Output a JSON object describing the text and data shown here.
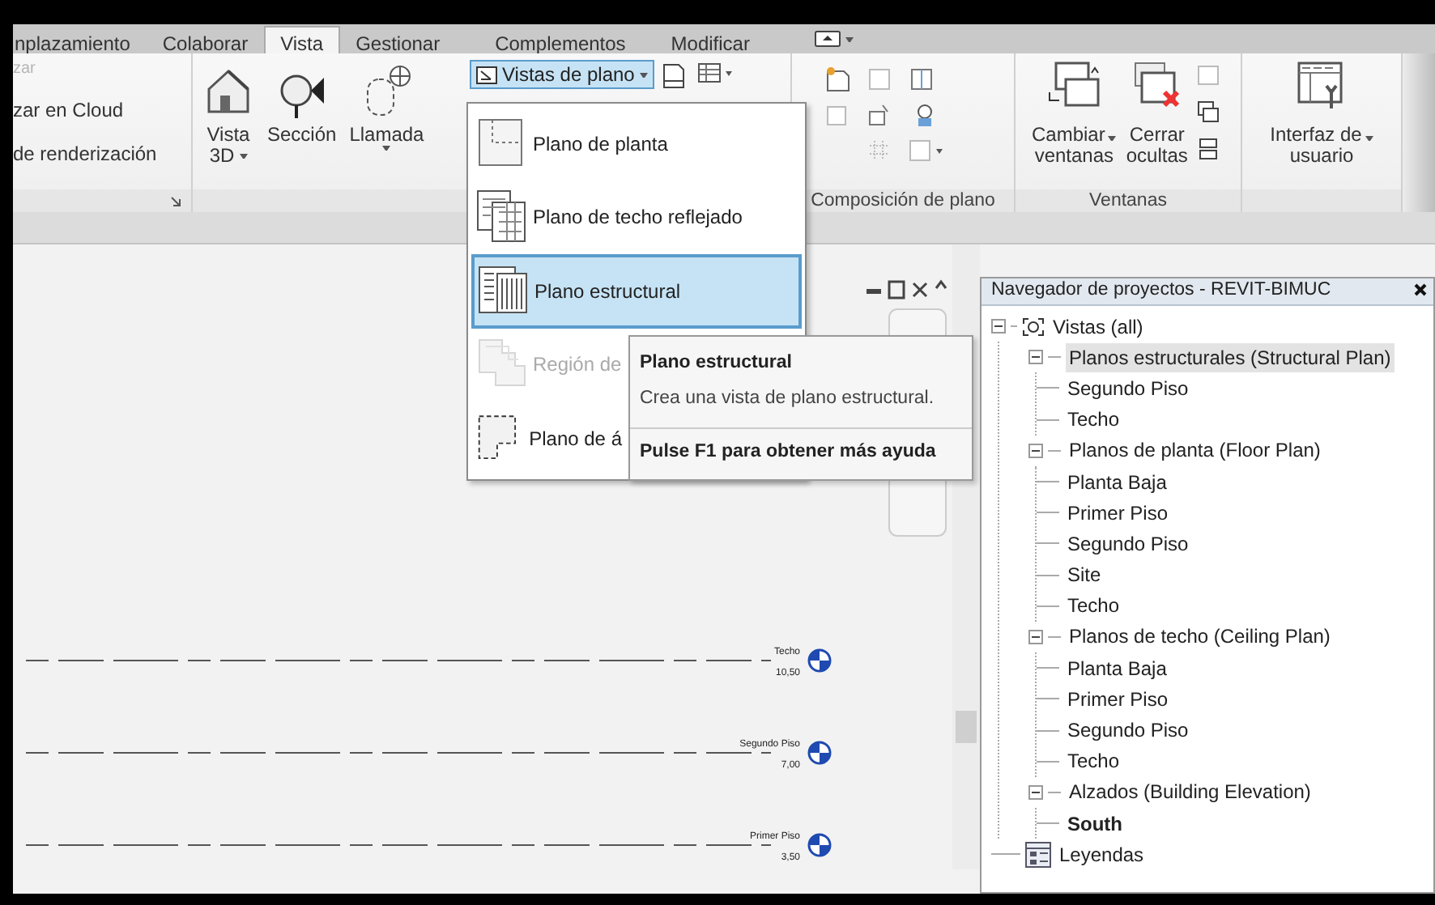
{
  "ribbon_tabs": [
    {
      "label": "nplazamiento",
      "selected": false
    },
    {
      "label": "Colaborar",
      "selected": false
    },
    {
      "label": "Vista",
      "selected": true
    },
    {
      "label": "Gestionar",
      "selected": false
    },
    {
      "label": "Complementos",
      "selected": false
    },
    {
      "label": "Modificar",
      "selected": false
    }
  ],
  "panel_cut": {
    "items": [
      {
        "label": "zar",
        "disabled": true
      },
      {
        "label": "zar en Cloud",
        "disabled": false
      },
      {
        "label": "de renderización",
        "disabled": false
      }
    ]
  },
  "create_panel": {
    "buttons": [
      {
        "kind": "view3d",
        "label": "Vista",
        "label_2": "3D",
        "dropdown": true
      },
      {
        "kind": "section",
        "label": "Sección",
        "dropdown": false
      },
      {
        "kind": "callout",
        "label": "Llamada",
        "dropdown": true
      }
    ]
  },
  "plan_views_button": {
    "label": "Vistas de plano",
    "expanded": true
  },
  "plan_menu": [
    {
      "kind": "floor",
      "label": "Plano de planta",
      "selected": false,
      "disabled": false
    },
    {
      "kind": "ceiling",
      "label": "Plano de techo reflejado",
      "selected": false,
      "disabled": false
    },
    {
      "kind": "structural",
      "label": "Plano estructural",
      "selected": true,
      "disabled": false
    },
    {
      "kind": "region",
      "label": "Región de",
      "selected": false,
      "disabled": true
    },
    {
      "kind": "area",
      "label": "Plano de á",
      "selected": false,
      "disabled": false
    }
  ],
  "tooltip": {
    "title": "Plano estructural",
    "description": "Crea una vista de plano estructural.",
    "help": "Pulse F1 para obtener más ayuda"
  },
  "sheet_panel": {
    "label": "Composición de plano"
  },
  "windows_panel": {
    "label": "Ventanas",
    "buttons": [
      {
        "kind": "switch",
        "label": "Cambiar",
        "label_2": "ventanas",
        "dropdown": true
      },
      {
        "kind": "close",
        "label": "Cerrar",
        "label_2": "ocultas",
        "dropdown": false
      }
    ]
  },
  "ui_button": {
    "label": "Interfaz de",
    "label_2": "usuario",
    "dropdown": true
  },
  "levels": [
    {
      "name": "Techo",
      "elevation": "10,50"
    },
    {
      "name": "Segundo Piso",
      "elevation": "7,00"
    },
    {
      "name": "Primer Piso",
      "elevation": "3,50"
    }
  ],
  "project_browser": {
    "title": "Navegador de proyectos - REVIT-BIMUC",
    "tree": [
      {
        "kind": "views",
        "label": "Vistas (all)",
        "expanded": true,
        "selected": false,
        "children": [
          {
            "label": "Planos estructurales (Structural Plan)",
            "expanded": true,
            "selected": true,
            "children": [
              {
                "label": "Segundo Piso",
                "selected": false,
                "current": false
              },
              {
                "label": "Techo",
                "selected": false,
                "current": false
              }
            ]
          },
          {
            "label": "Planos de planta (Floor Plan)",
            "expanded": true,
            "selected": false,
            "children": [
              {
                "label": "Planta Baja",
                "selected": false,
                "current": false
              },
              {
                "label": "Primer Piso",
                "selected": false,
                "current": false
              },
              {
                "label": "Segundo Piso",
                "selected": false,
                "current": false
              },
              {
                "label": "Site",
                "selected": false,
                "current": false
              },
              {
                "label": "Techo",
                "selected": false,
                "current": false
              }
            ]
          },
          {
            "label": "Planos de techo (Ceiling Plan)",
            "expanded": true,
            "selected": false,
            "children": [
              {
                "label": "Planta Baja",
                "selected": false,
                "current": false
              },
              {
                "label": "Primer Piso",
                "selected": false,
                "current": false
              },
              {
                "label": "Segundo Piso",
                "selected": false,
                "current": false
              },
              {
                "label": "Techo",
                "selected": false,
                "current": false
              }
            ]
          },
          {
            "label": "Alzados (Building Elevation)",
            "expanded": true,
            "selected": false,
            "children": [
              {
                "label": "South",
                "selected": false,
                "current": true
              }
            ]
          }
        ]
      },
      {
        "kind": "legends",
        "label": "Leyendas",
        "selected": false
      }
    ]
  }
}
